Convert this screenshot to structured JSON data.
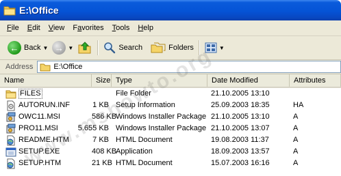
{
  "window": {
    "title": "E:\\Office"
  },
  "menubar": {
    "items": [
      {
        "accel": "F",
        "rest": "ile"
      },
      {
        "accel": "E",
        "rest": "dit"
      },
      {
        "accel": "V",
        "rest": "iew"
      },
      {
        "pre": "F",
        "accel": "a",
        "rest": "vorites"
      },
      {
        "accel": "T",
        "rest": "ools"
      },
      {
        "accel": "H",
        "rest": "elp"
      }
    ]
  },
  "toolbar": {
    "back_label": "Back",
    "search_label": "Search",
    "folders_label": "Folders"
  },
  "address": {
    "label": "Address",
    "value": "E:\\Office"
  },
  "columns": {
    "name": "Name",
    "size": "Size",
    "type": "Type",
    "date": "Date Modified",
    "attributes": "Attributes"
  },
  "files": [
    {
      "name": "FILES",
      "size": "",
      "type": "File Folder",
      "date": "21.10.2005 13:10",
      "attr": "",
      "icon": "folder-icon"
    },
    {
      "name": "AUTORUN.INF",
      "size": "1 KB",
      "type": "Setup Information",
      "date": "25.09.2003 18:35",
      "attr": "HA",
      "icon": "setup-info-icon"
    },
    {
      "name": "OWC11.MSI",
      "size": "586 KB",
      "type": "Windows Installer Package",
      "date": "21.10.2005 13:10",
      "attr": "A",
      "icon": "installer-package-icon"
    },
    {
      "name": "PRO11.MSI",
      "size": "5.655 KB",
      "type": "Windows Installer Package",
      "date": "21.10.2005 13:07",
      "attr": "A",
      "icon": "installer-package-icon"
    },
    {
      "name": "README.HTM",
      "size": "7 KB",
      "type": "HTML Document",
      "date": "19.08.2003 11:37",
      "attr": "A",
      "icon": "html-document-icon"
    },
    {
      "name": "SETUP.EXE",
      "size": "408 KB",
      "type": "Application",
      "date": "18.09.2003 13:57",
      "attr": "A",
      "icon": "application-icon"
    },
    {
      "name": "SETUP.HTM",
      "size": "21 KB",
      "type": "HTML Document",
      "date": "15.07.2003 16:16",
      "attr": "A",
      "icon": "html-document-icon"
    }
  ],
  "watermark": "www.mshowto.org"
}
